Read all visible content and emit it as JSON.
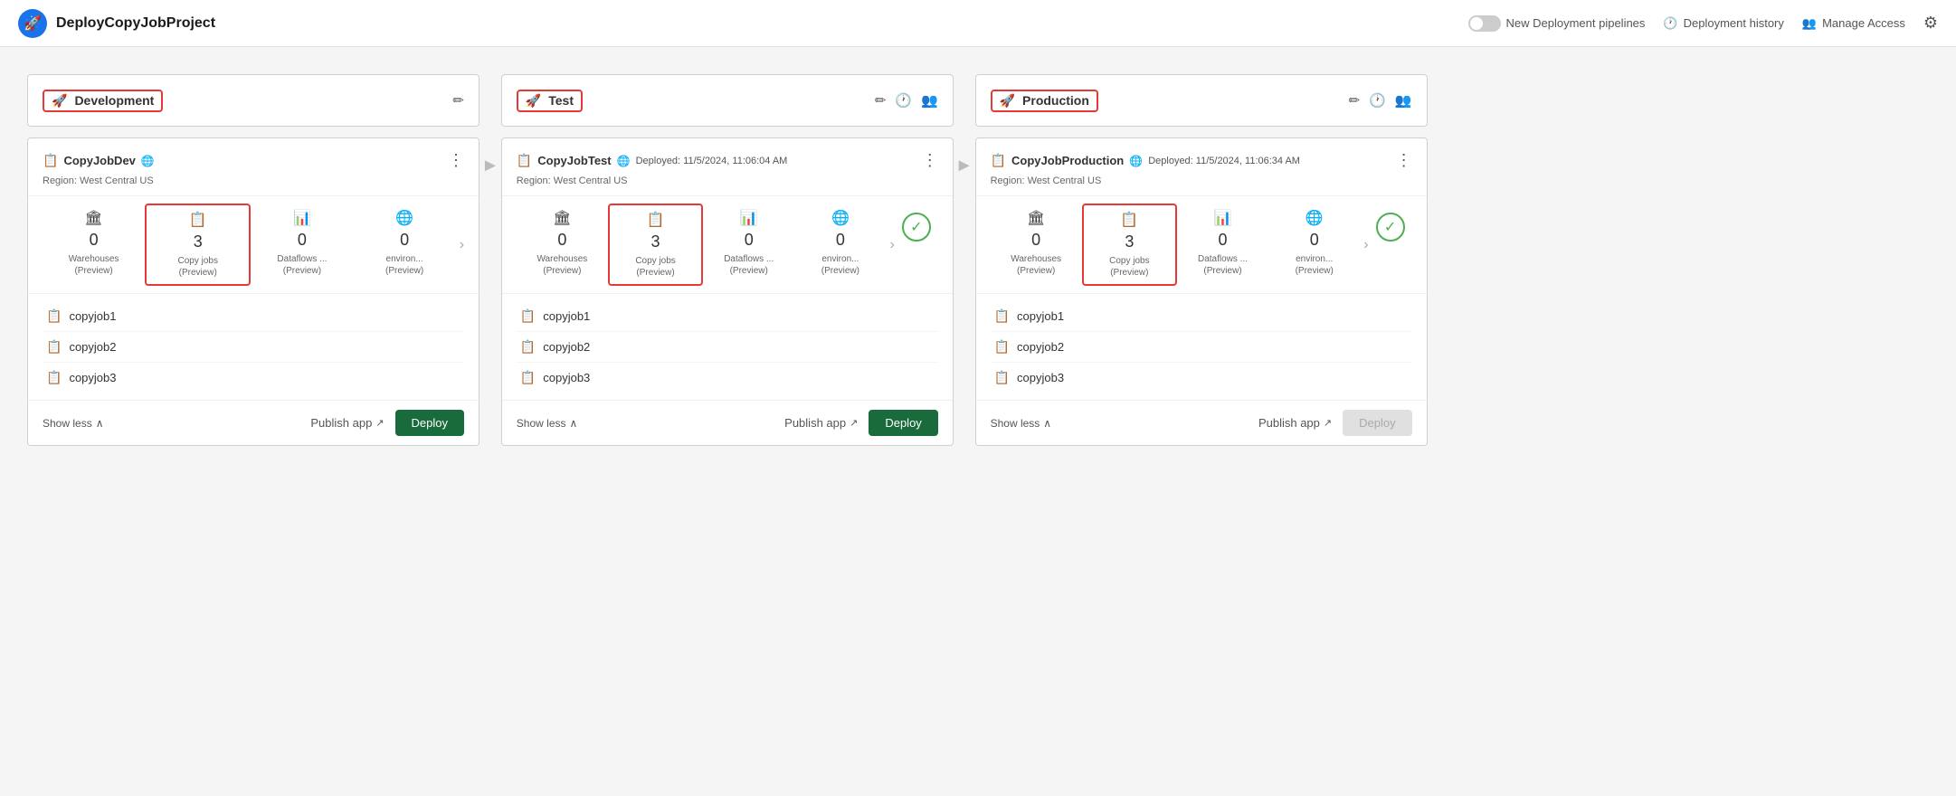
{
  "app": {
    "title": "DeployCopyJobProject",
    "icon": "🚀"
  },
  "header": {
    "toggle_label": "New Deployment pipelines",
    "history_label": "Deployment history",
    "access_label": "Manage Access"
  },
  "stages": [
    {
      "id": "development",
      "name": "Development",
      "highlighted": true,
      "actions": [
        "edit"
      ],
      "card": {
        "title": "CopyJobDev",
        "deployed": "",
        "region": "Region: West Central US",
        "metrics": [
          {
            "icon": "🏛",
            "value": "0",
            "label": "Warehouses\n(Preview)"
          },
          {
            "icon": "📋",
            "value": "3",
            "label": "Copy jobs\n(Preview)",
            "highlighted": true
          },
          {
            "icon": "📊",
            "value": "0",
            "label": "Dataflows ...\n(Preview)"
          },
          {
            "icon": "🌐",
            "value": "0",
            "label": "environ...\n(Preview)"
          }
        ],
        "items": [
          "copyjob1",
          "copyjob2",
          "copyjob3"
        ],
        "show_less": "Show less",
        "publish_label": "Publish app",
        "deploy_label": "Deploy",
        "deploy_disabled": false,
        "show_success": false
      }
    },
    {
      "id": "test",
      "name": "Test",
      "highlighted": true,
      "actions": [
        "edit",
        "history",
        "users"
      ],
      "card": {
        "title": "CopyJobTest",
        "deployed": "Deployed: 11/5/2024, 11:06:04 AM",
        "region": "Region: West Central US",
        "metrics": [
          {
            "icon": "🏛",
            "value": "0",
            "label": "Warehouses\n(Preview)"
          },
          {
            "icon": "📋",
            "value": "3",
            "label": "Copy jobs\n(Preview)",
            "highlighted": true
          },
          {
            "icon": "📊",
            "value": "0",
            "label": "Dataflows ...\n(Preview)"
          },
          {
            "icon": "🌐",
            "value": "0",
            "label": "environ...\n(Preview)"
          }
        ],
        "items": [
          "copyjob1",
          "copyjob2",
          "copyjob3"
        ],
        "show_less": "Show less",
        "publish_label": "Publish app",
        "deploy_label": "Deploy",
        "deploy_disabled": false,
        "show_success": true
      }
    },
    {
      "id": "production",
      "name": "Production",
      "highlighted": true,
      "actions": [
        "edit",
        "history",
        "users"
      ],
      "card": {
        "title": "CopyJobProduction",
        "deployed": "Deployed: 11/5/2024, 11:06:34 AM",
        "region": "Region: West Central US",
        "metrics": [
          {
            "icon": "🏛",
            "value": "0",
            "label": "Warehouses\n(Preview)"
          },
          {
            "icon": "📋",
            "value": "3",
            "label": "Copy jobs\n(Preview)",
            "highlighted": true
          },
          {
            "icon": "📊",
            "value": "0",
            "label": "Dataflows ...\n(Preview)"
          },
          {
            "icon": "🌐",
            "value": "0",
            "label": "environ...\n(Preview)"
          }
        ],
        "items": [
          "copyjob1",
          "copyjob2",
          "copyjob3"
        ],
        "show_less": "Show less",
        "publish_label": "Publish app",
        "deploy_label": "Deploy",
        "deploy_disabled": true,
        "show_success": true
      }
    }
  ]
}
